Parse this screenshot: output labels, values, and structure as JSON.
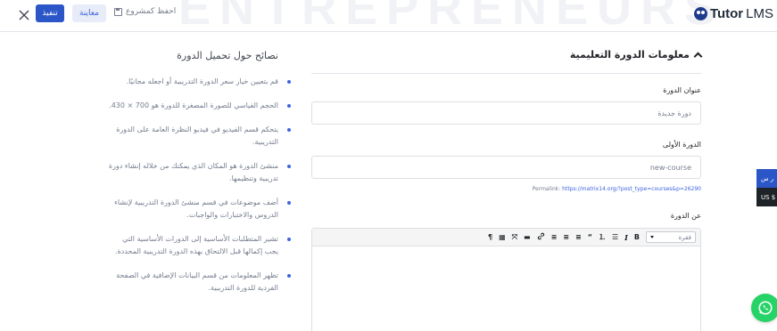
{
  "topbar": {
    "watermark": "ENTREPRENEURS",
    "publish_label": "تنفيذ",
    "preview_label": "معاينة",
    "save_draft_label": "احفظ كمشروع",
    "logo_tutor": "Tutor",
    "logo_lms": "LMS",
    "accent_color": "#2a56c7"
  },
  "tips": {
    "title": "نصائح حول تحميل الدورة",
    "items": [
      "قم بتعيين خيار سعر الدورة التدريبية أو اجعله مجانيًا.",
      "الحجم القياسي للصورة المصغرة للدورة هو 700 × 430.",
      "يتحكم قسم الفيديو في فيديو النظرة العامة على الدورة التدريبية.",
      "منشئ الدورة هو المكان الذي يمكنك من خلاله إنشاء دورة تدريبية وتنظيمها.",
      "أضف موضوعات في قسم منشئ الدورة التدريبية لإنشاء الدروس والاختبارات والواجبات.",
      "تشير المتطلبات الأساسية إلى الدورات الأساسية التي يجب إكمالها قبل الالتحاق بهذه الدورة التدريبية المحددة.",
      "تظهر المعلومات من قسم البيانات الإضافية في الصفحة الفردية للدورة التدريبية."
    ]
  },
  "form": {
    "section_title": "معلومات الدورة التعليمية",
    "title_label": "عنوان الدورة",
    "title_value": "دورة جديدة",
    "slug_label": "الدورة الأولى",
    "slug_value": "new-course",
    "permalink_label": "Permalink:",
    "permalink_url": "https://matrix14.org/?post_type=courses&p=26290",
    "about_label": "عن الدورة",
    "format_value": "فقرة"
  },
  "editor_tools": [
    {
      "name": "paragraph-mark-icon",
      "glyph": "¶"
    },
    {
      "name": "toolbar-toggle-icon",
      "glyph": "▦"
    },
    {
      "name": "fullscreen-icon",
      "glyph": "⤧"
    },
    {
      "name": "read-more-icon",
      "glyph": "▬"
    },
    {
      "name": "link-icon",
      "glyph": "🔗"
    },
    {
      "name": "align-right-icon",
      "glyph": "≡"
    },
    {
      "name": "align-center-icon",
      "glyph": "≡"
    },
    {
      "name": "align-left-icon",
      "glyph": "≡"
    },
    {
      "name": "blockquote-icon",
      "glyph": "“"
    },
    {
      "name": "numbered-list-icon",
      "glyph": "⒈"
    },
    {
      "name": "bullet-list-icon",
      "glyph": "☰"
    },
    {
      "name": "italic-icon",
      "glyph": "I"
    },
    {
      "name": "bold-icon",
      "glyph": "B"
    }
  ],
  "side": {
    "tab1": "ر س",
    "tab2": "US $"
  }
}
